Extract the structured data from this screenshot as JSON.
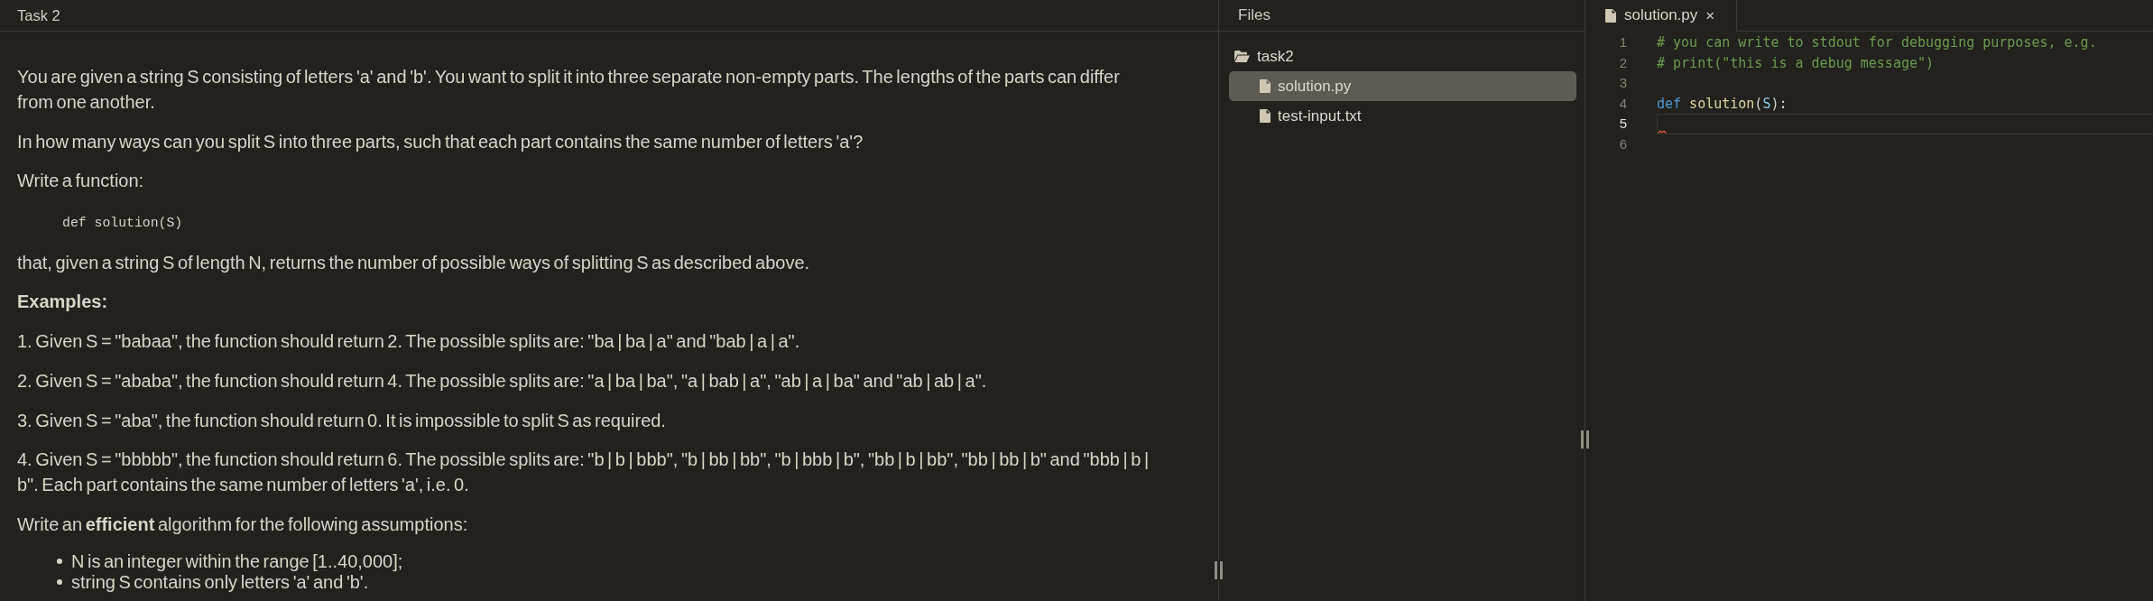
{
  "task_panel": {
    "title": "Task 2",
    "blocks": [
      {
        "kind": "paragraph",
        "text": "You are given a string S consisting of letters 'a' and 'b'. You want to split it into three separate non-empty parts. The lengths of the parts can differ from one another."
      },
      {
        "kind": "paragraph",
        "text": "In how many ways can you split S into three parts, such that each part contains the same number of letters 'a'?"
      },
      {
        "kind": "paragraph",
        "text": "Write a function:"
      },
      {
        "kind": "code",
        "text": "def solution(S)"
      },
      {
        "kind": "paragraph",
        "text": "that, given a string S of length N, returns the number of possible ways of splitting S as described above."
      },
      {
        "kind": "heading",
        "text": "Examples:"
      },
      {
        "kind": "paragraph",
        "text": "1. Given S = \"babaa\", the function should return 2. The possible splits are: \"ba | ba | a\" and \"bab | a | a\"."
      },
      {
        "kind": "paragraph",
        "text": "2. Given S = \"ababa\", the function should return 4. The possible splits are: \"a | ba | ba\", \"a | bab | a\", \"ab | a | ba\" and \"ab | ab | a\"."
      },
      {
        "kind": "paragraph",
        "text": "3. Given S = \"aba\", the function should return 0. It is impossible to split S as required."
      },
      {
        "kind": "paragraph",
        "text": "4. Given S = \"bbbbb\", the function should return 6. The possible splits are: \"b | b | bbb\", \"b | bb | bb\", \"b | bbb | b\", \"bb | b | bb\", \"bb | bb | b\" and \"bbb | b | b\". Each part contains the same number of letters 'a', i.e. 0."
      },
      {
        "kind": "paragraph",
        "text": "Write an **efficient** algorithm for the following assumptions:"
      },
      {
        "kind": "bullets",
        "items": [
          "N is an integer within the range [1..40,000];",
          "string S contains only letters 'a' and 'b'."
        ]
      }
    ]
  },
  "files_panel": {
    "title": "Files",
    "tree": [
      {
        "kind": "folder",
        "name": "task2",
        "expanded": true,
        "selected": false,
        "children": [
          {
            "kind": "file",
            "name": "solution.py",
            "selected": true
          },
          {
            "kind": "file",
            "name": "test-input.txt",
            "selected": false
          }
        ]
      }
    ]
  },
  "editor": {
    "tabs": [
      {
        "label": "solution.py",
        "close": "×",
        "selected": true
      }
    ],
    "lines": [
      {
        "number": "1",
        "current": false,
        "error": false,
        "tokens": [
          {
            "kind": "comment",
            "text": "# you can write to stdout for debugging purposes, e.g."
          }
        ]
      },
      {
        "number": "2",
        "current": false,
        "error": false,
        "tokens": [
          {
            "kind": "comment",
            "text": "# print(\"this is a debug message\")"
          }
        ]
      },
      {
        "number": "3",
        "current": false,
        "error": false
      },
      {
        "number": "4",
        "current": false,
        "error": false,
        "tokens": [
          {
            "kind": "keyword",
            "text": "def"
          },
          {
            "kind": "function",
            "text": "solution",
            "gap_before": true
          },
          {
            "kind": "plain",
            "text": "("
          },
          {
            "kind": "param",
            "text": "S"
          },
          {
            "kind": "plain",
            "text": "):"
          }
        ]
      },
      {
        "number": "5",
        "current": true,
        "error": true
      },
      {
        "number": "6",
        "current": false,
        "error": false
      }
    ]
  }
}
